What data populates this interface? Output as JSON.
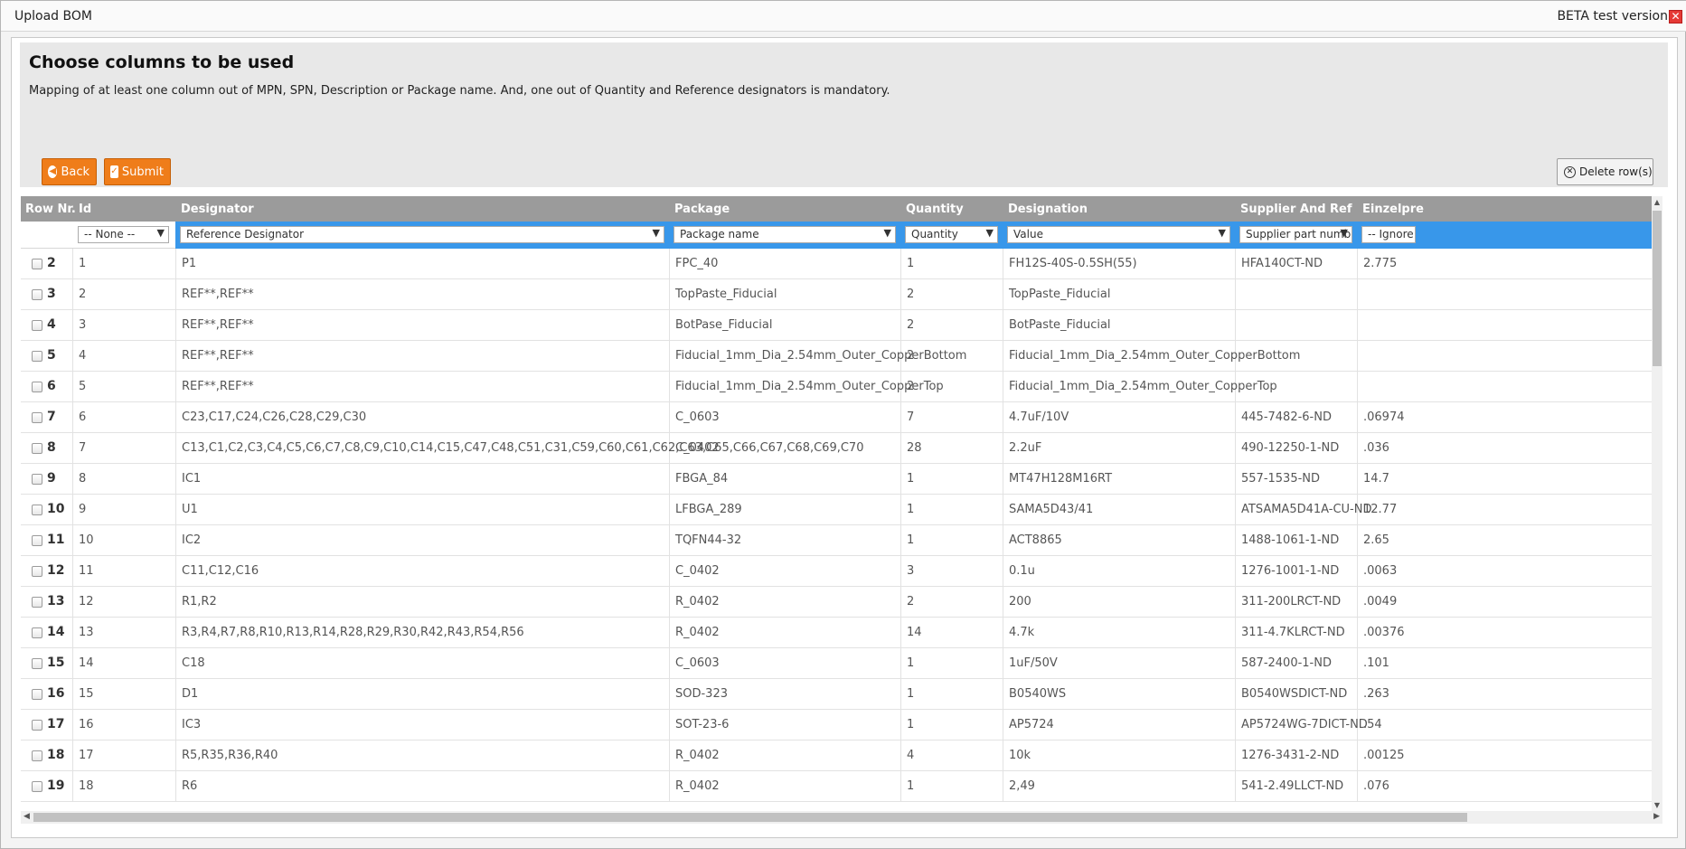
{
  "window": {
    "title": "Upload BOM",
    "beta_label": "BETA test version",
    "close_glyph": "✕"
  },
  "header": {
    "heading": "Choose columns to be used",
    "subtext": "Mapping of at least one column out of MPN, SPN, Description or Package name. And, one out of Quantity and Reference designators is mandatory."
  },
  "toolbar": {
    "back_label": "Back",
    "submit_label": "Submit",
    "delete_label": "Delete row(s)"
  },
  "columns": [
    "Row Nr.",
    "Id",
    "Designator",
    "Package",
    "Quantity",
    "Designation",
    "Supplier And Ref",
    "Einzelpre"
  ],
  "mappings": [
    "-- None --",
    "Reference Designator",
    "Package name",
    "Quantity",
    "Value",
    "Supplier part number (",
    "-- Ignore"
  ],
  "rows": [
    {
      "nr": "2",
      "id": "1",
      "designator": "P1",
      "package": "FPC_40",
      "qty": "1",
      "designation": "FH12S-40S-0.5SH(55)",
      "supplier": "HFA140CT-ND",
      "price": "2.775"
    },
    {
      "nr": "3",
      "id": "2",
      "designator": "REF**,REF**",
      "package": "TopPaste_Fiducial",
      "qty": "2",
      "designation": "TopPaste_Fiducial",
      "supplier": "",
      "price": ""
    },
    {
      "nr": "4",
      "id": "3",
      "designator": "REF**,REF**",
      "package": "BotPase_Fiducial",
      "qty": "2",
      "designation": "BotPaste_Fiducial",
      "supplier": "",
      "price": ""
    },
    {
      "nr": "5",
      "id": "4",
      "designator": "REF**,REF**",
      "package": "Fiducial_1mm_Dia_2.54mm_Outer_CopperBottom",
      "qty": "2",
      "designation": "Fiducial_1mm_Dia_2.54mm_Outer_CopperBottom",
      "supplier": "",
      "price": ""
    },
    {
      "nr": "6",
      "id": "5",
      "designator": "REF**,REF**",
      "package": "Fiducial_1mm_Dia_2.54mm_Outer_CopperTop",
      "qty": "2",
      "designation": "Fiducial_1mm_Dia_2.54mm_Outer_CopperTop",
      "supplier": "",
      "price": ""
    },
    {
      "nr": "7",
      "id": "6",
      "designator": "C23,C17,C24,C26,C28,C29,C30",
      "package": "C_0603",
      "qty": "7",
      "designation": "4.7uF/10V",
      "supplier": "445-7482-6-ND",
      "price": ".06974"
    },
    {
      "nr": "8",
      "id": "7",
      "designator": "C13,C1,C2,C3,C4,C5,C6,C7,C8,C9,C10,C14,C15,C47,C48,C51,C31,C59,C60,C61,C62,C63,C65,C66,C67,C68,C69,C70",
      "package": "C_0402",
      "qty": "28",
      "designation": "2.2uF",
      "supplier": "490-12250-1-ND",
      "price": ".036"
    },
    {
      "nr": "9",
      "id": "8",
      "designator": "IC1",
      "package": "FBGA_84",
      "qty": "1",
      "designation": "MT47H128M16RT",
      "supplier": "557-1535-ND",
      "price": "14.7"
    },
    {
      "nr": "10",
      "id": "9",
      "designator": "U1",
      "package": "LFBGA_289",
      "qty": "1",
      "designation": "SAMA5D43/41",
      "supplier": "ATSAMA5D41A-CU-ND",
      "price": "12.77"
    },
    {
      "nr": "11",
      "id": "10",
      "designator": "IC2",
      "package": "TQFN44-32",
      "qty": "1",
      "designation": "ACT8865",
      "supplier": "1488-1061-1-ND",
      "price": "2.65"
    },
    {
      "nr": "12",
      "id": "11",
      "designator": "C11,C12,C16",
      "package": "C_0402",
      "qty": "3",
      "designation": "0.1u",
      "supplier": "1276-1001-1-ND",
      "price": ".0063"
    },
    {
      "nr": "13",
      "id": "12",
      "designator": "R1,R2",
      "package": "R_0402",
      "qty": "2",
      "designation": "200",
      "supplier": "311-200LRCT-ND",
      "price": ".0049"
    },
    {
      "nr": "14",
      "id": "13",
      "designator": "R3,R4,R7,R8,R10,R13,R14,R28,R29,R30,R42,R43,R54,R56",
      "package": "R_0402",
      "qty": "14",
      "designation": "4.7k",
      "supplier": "311-4.7KLRCT-ND",
      "price": ".00376"
    },
    {
      "nr": "15",
      "id": "14",
      "designator": "C18",
      "package": "C_0603",
      "qty": "1",
      "designation": "1uF/50V",
      "supplier": "587-2400-1-ND",
      "price": ".101"
    },
    {
      "nr": "16",
      "id": "15",
      "designator": "D1",
      "package": "SOD-323",
      "qty": "1",
      "designation": "B0540WS",
      "supplier": "B0540WSDICT-ND",
      "price": ".263"
    },
    {
      "nr": "17",
      "id": "16",
      "designator": "IC3",
      "package": "SOT-23-6",
      "qty": "1",
      "designation": "AP5724",
      "supplier": "AP5724WG-7DICT-ND",
      "price": ".54"
    },
    {
      "nr": "18",
      "id": "17",
      "designator": "R5,R35,R36,R40",
      "package": "R_0402",
      "qty": "4",
      "designation": "10k",
      "supplier": "1276-3431-2-ND",
      "price": ".00125"
    },
    {
      "nr": "19",
      "id": "18",
      "designator": "R6",
      "package": "R_0402",
      "qty": "1",
      "designation": "2,49",
      "supplier": "541-2.49LLCT-ND",
      "price": ".076"
    }
  ]
}
